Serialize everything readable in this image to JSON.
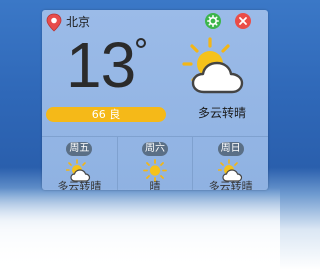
{
  "header": {
    "city": "北京",
    "settings_icon": "gear-icon",
    "close_icon": "close-icon",
    "location_icon": "map-pin-icon"
  },
  "current": {
    "temperature": "13",
    "unit_symbol": "°",
    "aqi_value": "66",
    "aqi_level": "良",
    "aqi_label": "66 良",
    "condition": "多云转晴",
    "condition_icon": "partly-cloudy-icon"
  },
  "forecast": [
    {
      "day": "周五",
      "icon": "partly-cloudy-icon",
      "condition": "多云转晴"
    },
    {
      "day": "周六",
      "icon": "sunny-icon",
      "condition": "晴"
    },
    {
      "day": "周日",
      "icon": "partly-cloudy-icon",
      "condition": "多云转晴"
    }
  ],
  "colors": {
    "aqi_good": "#f5b918",
    "settings_green": "#3cb54a",
    "close_red": "#ea4d47",
    "widget_blue": "#9bbbe8",
    "pin_red": "#e74c4c"
  }
}
